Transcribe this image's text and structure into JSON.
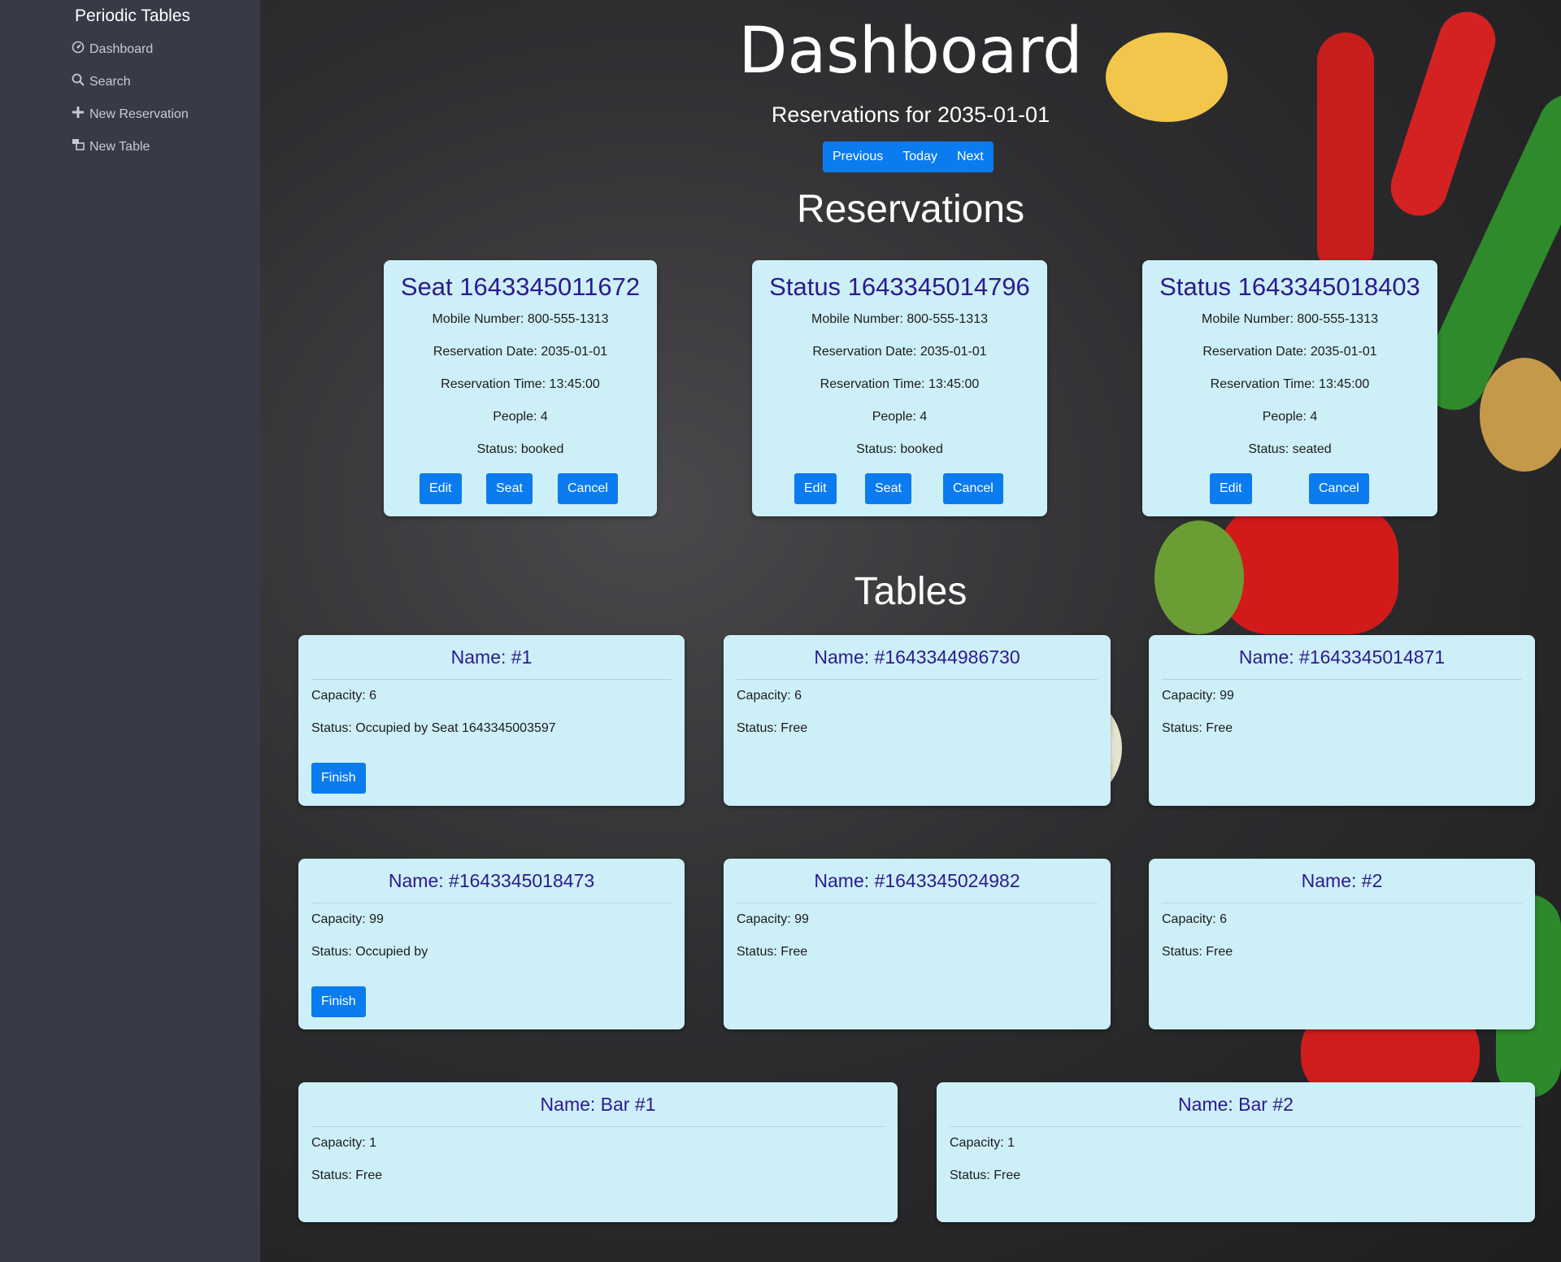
{
  "sidebar": {
    "brand": "Periodic Tables",
    "items": [
      {
        "label": "Dashboard",
        "icon": "dashboard-icon"
      },
      {
        "label": "Search",
        "icon": "search-icon"
      },
      {
        "label": "New Reservation",
        "icon": "plus-icon"
      },
      {
        "label": "New Table",
        "icon": "table-icon"
      }
    ]
  },
  "header": {
    "title": "Dashboard",
    "subtitle": "Reservations for 2035-01-01",
    "nav": {
      "previous": "Previous",
      "today": "Today",
      "next": "Next"
    },
    "reservations_heading": "Reservations",
    "tables_heading": "Tables"
  },
  "reservations": [
    {
      "title": "Seat 1643345011672",
      "mobile": "Mobile Number: 800-555-1313",
      "date": "Reservation Date: 2035-01-01",
      "time": "Reservation Time: 13:45:00",
      "people": "People: 4",
      "status": "Status: booked",
      "buttons": {
        "edit": "Edit",
        "seat": "Seat",
        "cancel": "Cancel"
      }
    },
    {
      "title": "Status 1643345014796",
      "mobile": "Mobile Number: 800-555-1313",
      "date": "Reservation Date: 2035-01-01",
      "time": "Reservation Time: 13:45:00",
      "people": "People: 4",
      "status": "Status: booked",
      "buttons": {
        "edit": "Edit",
        "seat": "Seat",
        "cancel": "Cancel"
      }
    },
    {
      "title": "Status 1643345018403",
      "mobile": "Mobile Number: 800-555-1313",
      "date": "Reservation Date: 2035-01-01",
      "time": "Reservation Time: 13:45:00",
      "people": "People: 4",
      "status": "Status: seated",
      "buttons": {
        "edit": "Edit",
        "cancel": "Cancel"
      }
    }
  ],
  "tables": [
    {
      "name": "Name: #1",
      "capacity": "Capacity: 6",
      "status": "Status: Occupied by Seat 1643345003597",
      "finish": "Finish"
    },
    {
      "name": "Name: #1643344986730",
      "capacity": "Capacity: 6",
      "status": "Status: Free"
    },
    {
      "name": "Name: #1643345014871",
      "capacity": "Capacity: 99",
      "status": "Status: Free"
    },
    {
      "name": "Name: #1643345018473",
      "capacity": "Capacity: 99",
      "status": "Status: Occupied by",
      "finish": "Finish"
    },
    {
      "name": "Name: #1643345024982",
      "capacity": "Capacity: 99",
      "status": "Status: Free"
    },
    {
      "name": "Name: #2",
      "capacity": "Capacity: 6",
      "status": "Status: Free"
    },
    {
      "name": "Name: Bar #1",
      "capacity": "Capacity: 1",
      "status": "Status: Free"
    },
    {
      "name": "Name: Bar #2",
      "capacity": "Capacity: 1",
      "status": "Status: Free"
    }
  ],
  "colors": {
    "sidebar": "#383a47",
    "card": "#cdeff7",
    "card_title": "#2c1a8f",
    "button": "#0b7bf0"
  }
}
